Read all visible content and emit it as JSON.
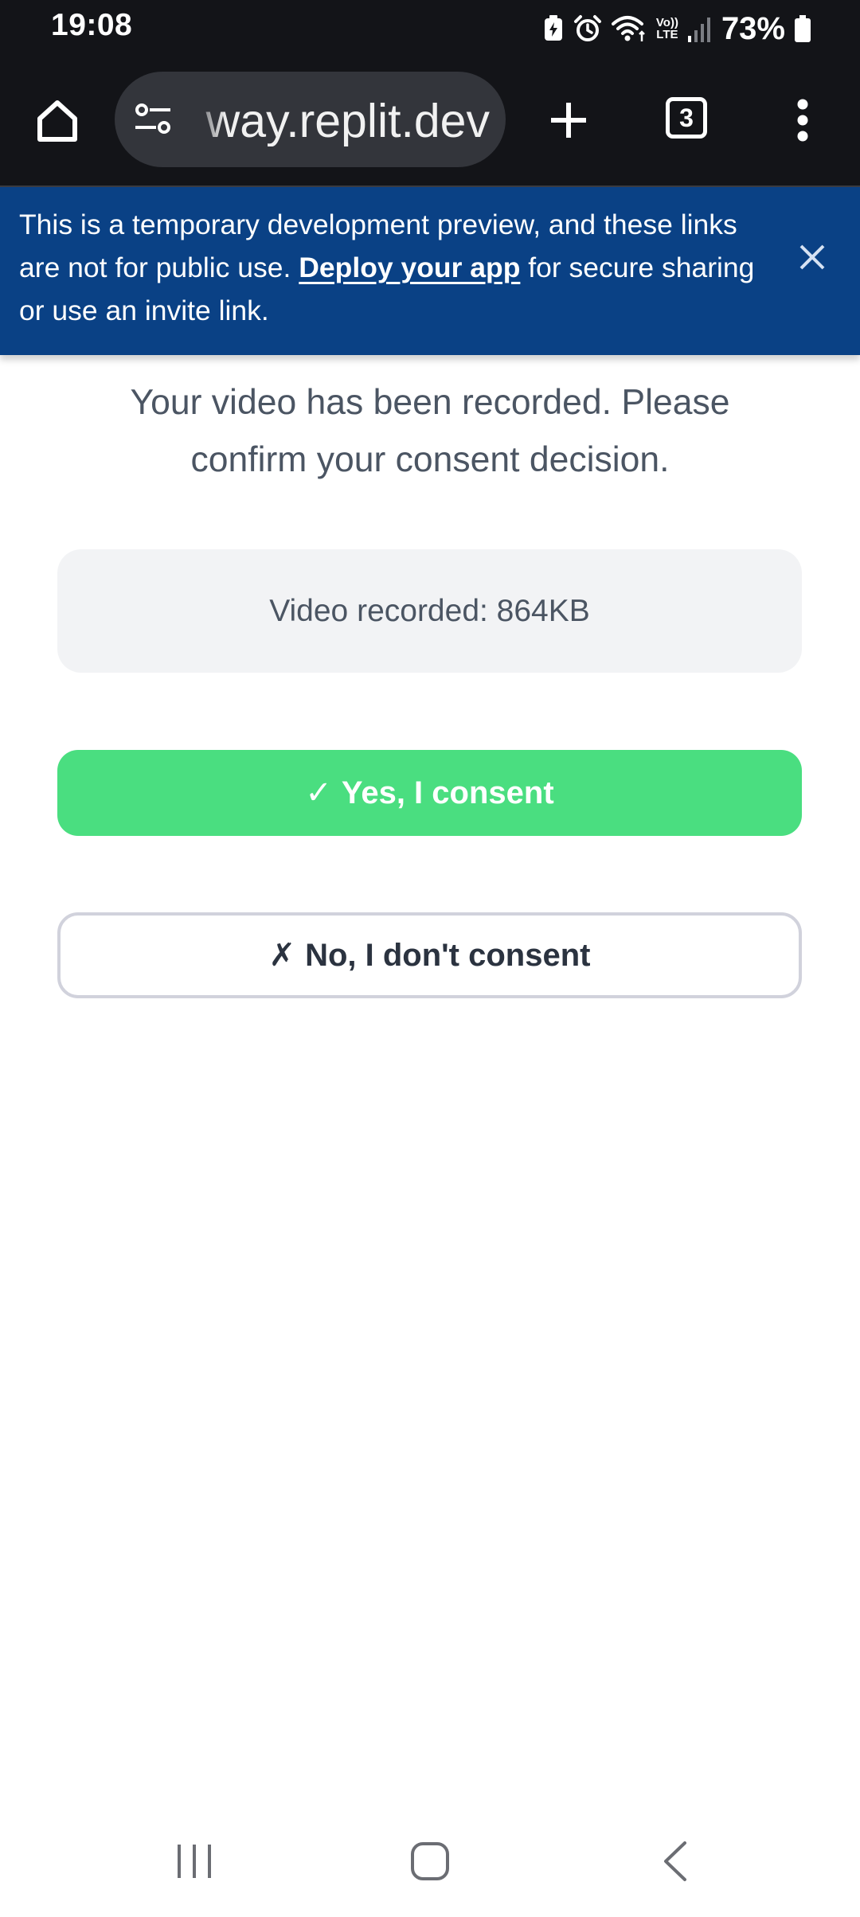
{
  "status_bar": {
    "time": "19:08",
    "battery_percent": "73%",
    "network_label_top": "Vo))",
    "network_label_bottom": "LTE",
    "icons": [
      "battery-saver-icon",
      "alarm-icon",
      "wifi-icon",
      "volte-icon",
      "signal-icon",
      "battery-icon"
    ]
  },
  "browser": {
    "url": "way.replit.dev",
    "tab_count": "3",
    "icons": [
      "home-icon",
      "site-settings-icon",
      "plus-icon",
      "tab-switcher-icon",
      "more-vert-icon"
    ]
  },
  "banner": {
    "text_before": "This is a temporary development preview, and these links are not for public use. ",
    "link_text": "Deploy your app",
    "text_after": " for secure sharing or use an invite link.",
    "close_icon": "close-icon",
    "background": "#0a4185"
  },
  "main": {
    "message": "Your video has been recorded. Please confirm your consent decision.",
    "video_info": "Video recorded: 864KB",
    "consent_yes_symbol": "✓",
    "consent_yes_label": "Yes, I consent",
    "consent_no_symbol": "✗",
    "consent_no_label": "No, I don't consent",
    "accent_green": "#4ade80"
  },
  "nav_bar": {
    "icons": [
      "recent-apps-icon",
      "home-nav-icon",
      "back-icon"
    ]
  }
}
